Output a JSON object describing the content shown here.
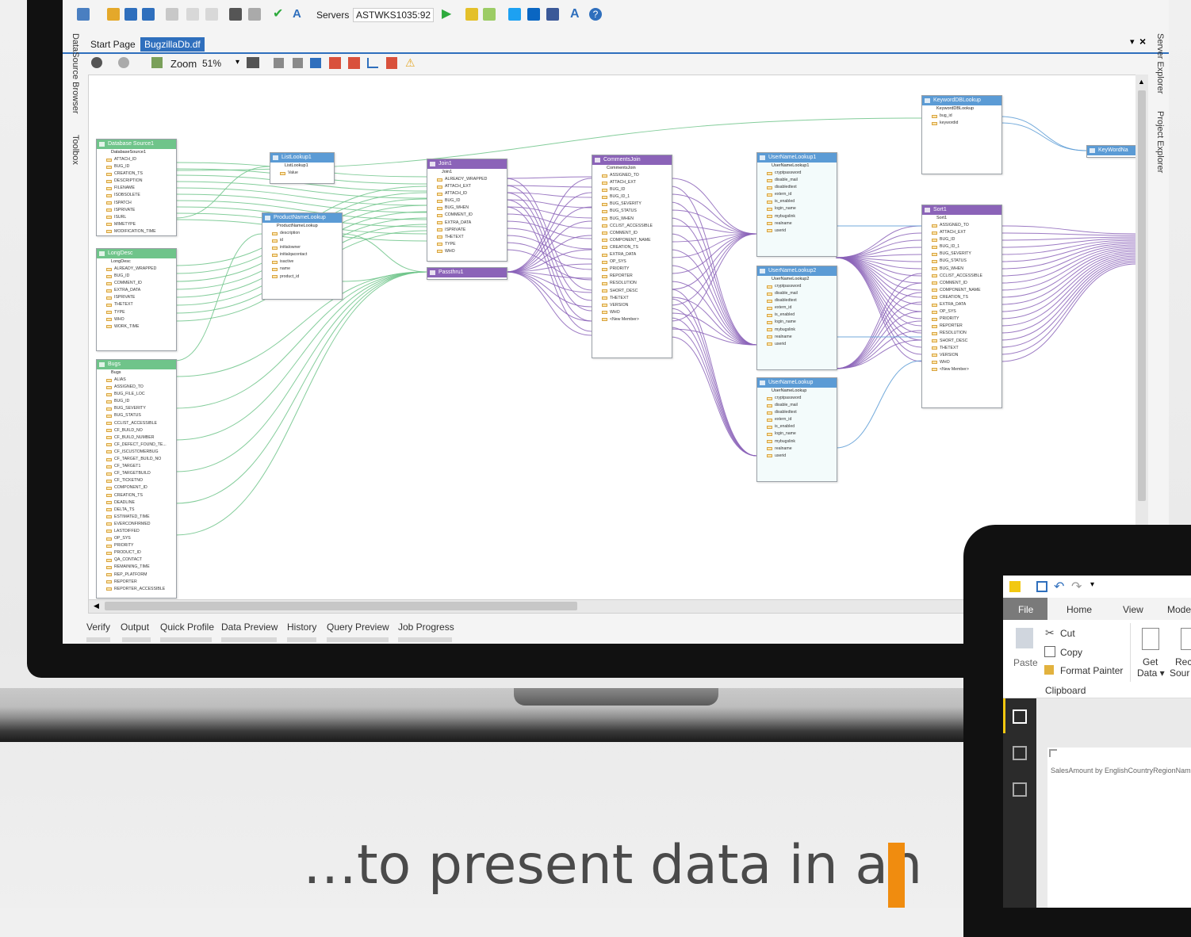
{
  "toolbar": {
    "servers_label": "Servers",
    "server_value": "ASTWKS1035:92"
  },
  "doc_tabs": [
    {
      "label": "Start Page"
    },
    {
      "label": "BugzillaDb.df"
    }
  ],
  "zoom": {
    "label": "Zoom",
    "value": "51%"
  },
  "side_panels": {
    "left": [
      "DataSource Browser",
      "Toolbox"
    ],
    "right": [
      "Server Explorer",
      "Project Explorer"
    ]
  },
  "bottom_tabs": [
    "Verify",
    "Output",
    "Quick Profile",
    "Data Preview",
    "History",
    "Query Preview",
    "Job Progress"
  ],
  "nodes": [
    {
      "title": "Database Source1",
      "sub": "DatabaseSource1",
      "color": "green",
      "fields": [
        "ATTACH_ID",
        "BUG_ID",
        "CREATION_TS",
        "DESCRIPTION",
        "FILENAME",
        "ISOBSOLETE",
        "ISPATCH",
        "ISPRIVATE",
        "ISURL",
        "MIMETYPE",
        "MODIFICATION_TIME"
      ]
    },
    {
      "title": "LongDesc",
      "sub": "LongDesc",
      "color": "green",
      "fields": [
        "ALREADY_WRAPPED",
        "BUG_ID",
        "COMMENT_ID",
        "EXTRA_DATA",
        "ISPRIVATE",
        "THETEXT",
        "TYPE",
        "WHO",
        "WORK_TIME"
      ]
    },
    {
      "title": "Bugs",
      "sub": "Bugs",
      "color": "green",
      "fields": [
        "ALIAS",
        "ASSIGNED_TO",
        "BUG_FILE_LOC",
        "BUG_ID",
        "BUG_SEVERITY",
        "BUG_STATUS",
        "CCLIST_ACCESSIBLE",
        "CF_BUILD_NO",
        "CF_BUILD_NUMBER",
        "CF_DEFECT_FOUND_TE...",
        "CF_ISCUSTOMERBUG",
        "CF_TARGET_BUILD_NO",
        "CF_TARGET1",
        "CF_TARGETBUILD",
        "CF_TICKETNO",
        "COMPONENT_ID",
        "CREATION_TS",
        "DEADLINE",
        "DELTA_TS",
        "ESTIMATED_TIME",
        "EVERCONFIRMED",
        "LASTDIFFED",
        "OP_SYS",
        "PRIORITY",
        "PRODUCT_ID",
        "QA_CONTACT",
        "REMAINING_TIME",
        "REP_PLATFORM",
        "REPORTER",
        "REPORTER_ACCESSIBLE"
      ]
    },
    {
      "title": "ListLookup1",
      "sub": "ListLookup1",
      "color": "blue",
      "fields": [
        "Value"
      ]
    },
    {
      "title": "ProductNameLookup",
      "sub": "ProductNameLookup",
      "color": "blue",
      "fields": [
        "description",
        "id",
        "initialowner",
        "initialqacontact",
        "isactive",
        "name",
        "product_id"
      ]
    },
    {
      "title": "Join1",
      "sub": "Join1",
      "color": "purple",
      "fields": [
        "ALREADY_WRAPPED",
        "ATTACH_EXT",
        "ATTACH_ID",
        "BUG_ID",
        "BUG_WHEN",
        "COMMENT_ID",
        "EXTRA_DATA",
        "ISPRIVATE",
        "THETEXT",
        "TYPE",
        "WHO"
      ]
    },
    {
      "title": "Passthru1",
      "sub": "",
      "color": "purple",
      "fields": []
    },
    {
      "title": "CommentsJoin",
      "sub": "CommentsJoin",
      "color": "purple",
      "fields": [
        "ASSIGNED_TO",
        "ATTACH_EXT",
        "BUG_ID",
        "BUG_ID_1",
        "BUG_SEVERITY",
        "BUG_STATUS",
        "BUG_WHEN",
        "CCLIST_ACCESSIBLE",
        "COMMENT_ID",
        "COMPONENT_NAME",
        "CREATION_TS",
        "EXTRA_DATA",
        "OP_SYS",
        "PRIORITY",
        "REPORTER",
        "RESOLUTION",
        "SHORT_DESC",
        "THETEXT",
        "VERSION",
        "WHO",
        "<New Member>"
      ]
    },
    {
      "title": "UserNameLookup1",
      "sub": "UserNameLookup1",
      "color": "blue",
      "fields": [
        "cryptpassword",
        "disable_mail",
        "disabledtext",
        "extern_id",
        "is_enabled",
        "login_name",
        "mybugslink",
        "realname",
        "userid"
      ]
    },
    {
      "title": "UserNameLookup2",
      "sub": "UserNameLookup2",
      "color": "blue",
      "fields": [
        "cryptpassword",
        "disable_mail",
        "disabledtext",
        "extern_id",
        "is_enabled",
        "login_name",
        "mybugslink",
        "realname",
        "userid"
      ]
    },
    {
      "title": "UserNameLookup",
      "sub": "UserNameLookup",
      "color": "blue",
      "fields": [
        "cryptpassword",
        "disable_mail",
        "disabledtext",
        "extern_id",
        "is_enabled",
        "login_name",
        "mybugslink",
        "realname",
        "userid"
      ]
    },
    {
      "title": "KeywordDBLookup",
      "sub": "KeywordDBLookup",
      "color": "blue",
      "fields": [
        "bug_id",
        "keywordid"
      ]
    },
    {
      "title": "KeyWordNa",
      "sub": "",
      "color": "blue",
      "fields": []
    },
    {
      "title": "Sort1",
      "sub": "Sort1",
      "color": "purple",
      "fields": [
        "ASSIGNED_TO",
        "ATTACH_EXT",
        "BUG_ID",
        "BUG_ID_1",
        "BUG_SEVERITY",
        "BUG_STATUS",
        "BUG_WHEN",
        "CCLIST_ACCESSIBLE",
        "COMMENT_ID",
        "COMPONENT_NAME",
        "CREATION_TS",
        "EXTRA_DATA",
        "OP_SYS",
        "PRIORITY",
        "REPORTER",
        "RESOLUTION",
        "SHORT_DESC",
        "THETEXT",
        "VERSION",
        "WHO",
        "<New Member>"
      ]
    }
  ],
  "pbi": {
    "tabs": [
      "File",
      "Home",
      "View",
      "Mode"
    ],
    "clipboard": {
      "paste": "Paste",
      "cut": "Cut",
      "copy": "Copy",
      "format_painter": "Format Painter",
      "group": "Clipboard"
    },
    "get_data": [
      "Get",
      "Data ▾"
    ],
    "recent": [
      "Rec",
      "Sour"
    ],
    "chart_title": "SalesAmount by EnglishCountryRegionName"
  },
  "tagline": "…to present data in an",
  "colors": {
    "accent_blue": "#2f6fbd",
    "green": "#6fc48a",
    "blue": "#5b9bd5",
    "purple": "#8b63b8",
    "orange": "#f08c0f"
  }
}
